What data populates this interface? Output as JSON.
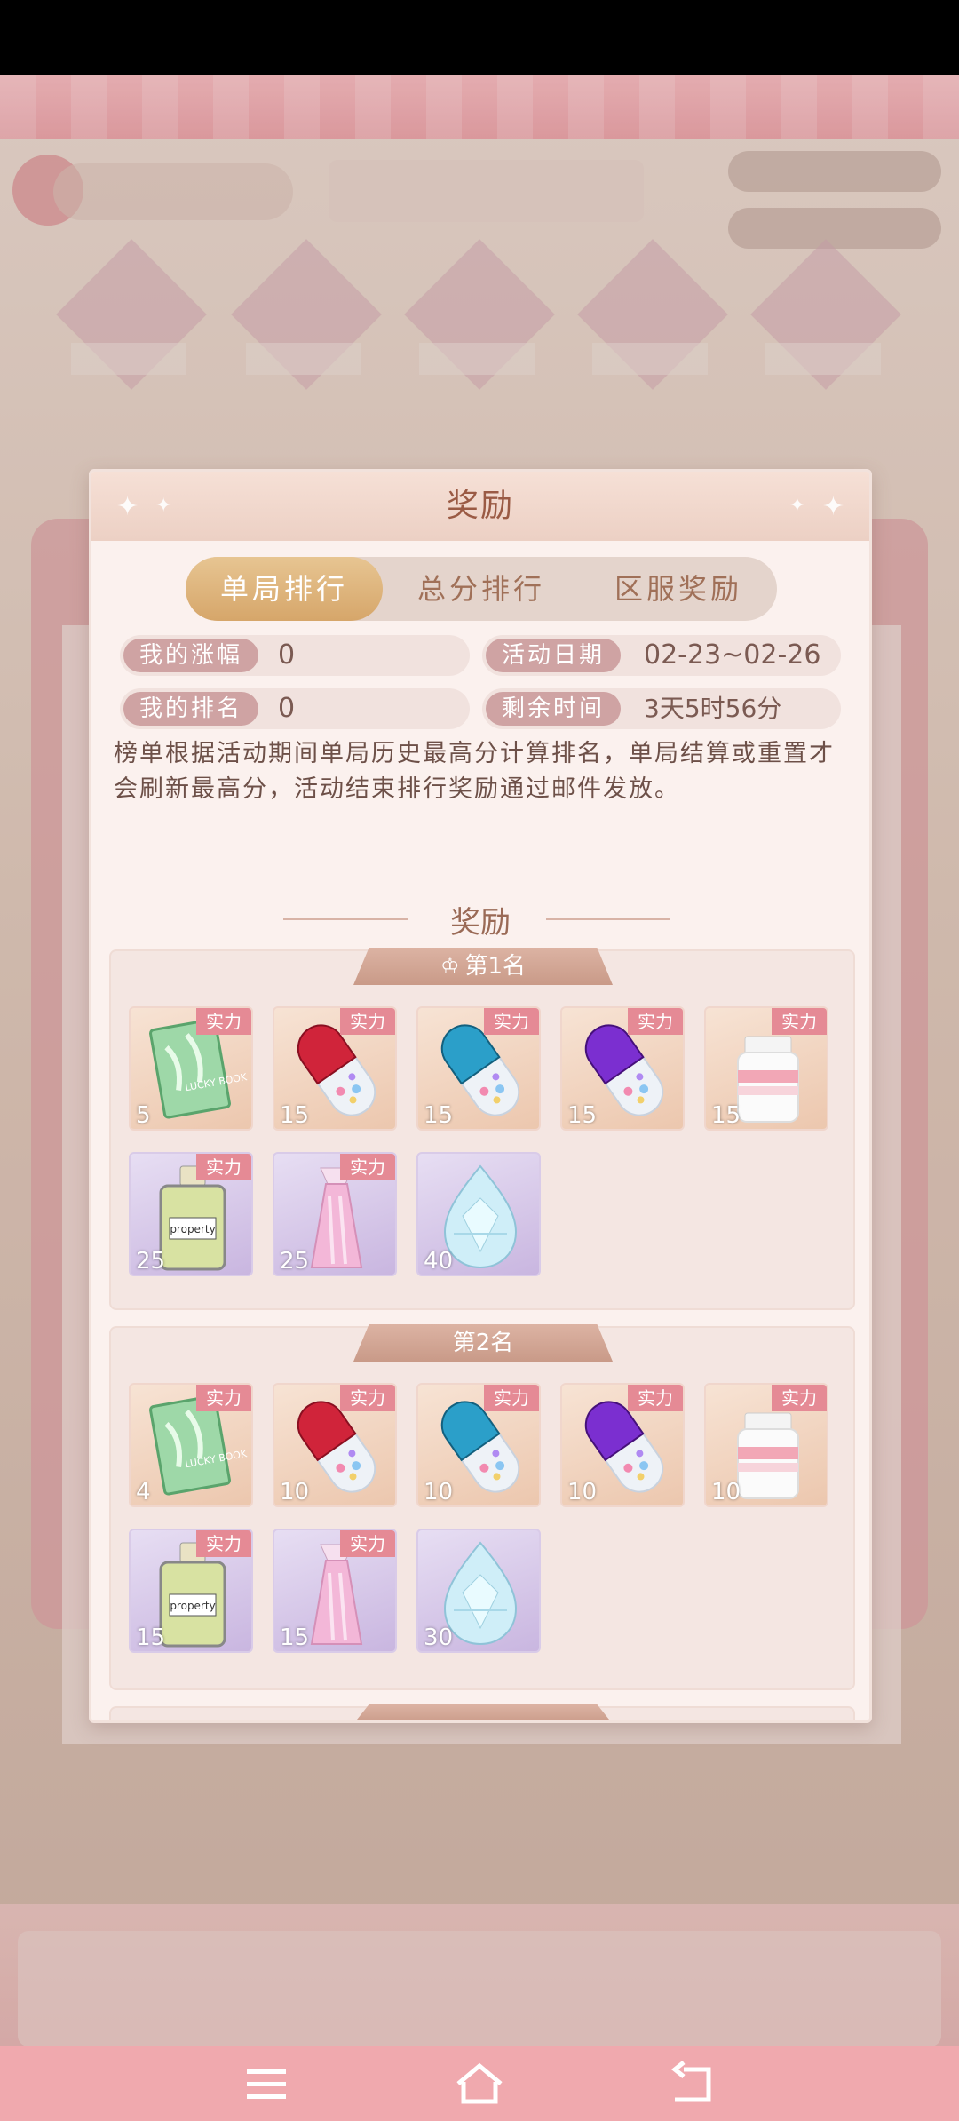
{
  "modal": {
    "title": "奖励",
    "tabs": [
      {
        "label": "单局排行",
        "active": true
      },
      {
        "label": "总分排行",
        "active": false
      },
      {
        "label": "区服奖励",
        "active": false
      }
    ],
    "info": {
      "my_rise_label": "我的涨幅",
      "my_rise_value": "0",
      "my_rank_label": "我的排名",
      "my_rank_value": "0",
      "event_date_label": "活动日期",
      "event_date_value": "02-23~02-26",
      "remaining_label": "剩余时间",
      "remaining_value": "3天5时56分"
    },
    "description": "榜单根据活动期间单局历史最高分计算排名，单局结算或重置才会刷新最高分，活动结束排行奖励通过邮件发放。",
    "rewards_title": "奖励",
    "ranks": [
      {
        "label": "第1名",
        "items": [
          {
            "icon": "lucky-book-icon",
            "qty": "5",
            "badge": "实力"
          },
          {
            "icon": "red-capsule-icon",
            "qty": "15",
            "badge": "实力"
          },
          {
            "icon": "blue-capsule-icon",
            "qty": "15",
            "badge": "实力"
          },
          {
            "icon": "purple-capsule-icon",
            "qty": "15",
            "badge": "实力"
          },
          {
            "icon": "pill-bottle-icon",
            "qty": "15",
            "badge": "实力"
          },
          {
            "icon": "perfume-bottle-icon",
            "qty": "25",
            "badge": "实力",
            "label_text": "property"
          },
          {
            "icon": "pink-potion-icon",
            "qty": "25",
            "badge": "实力"
          },
          {
            "icon": "diamond-icon",
            "qty": "40",
            "badge": ""
          }
        ]
      },
      {
        "label": "第2名",
        "items": [
          {
            "icon": "lucky-book-icon",
            "qty": "4",
            "badge": "实力"
          },
          {
            "icon": "red-capsule-icon",
            "qty": "10",
            "badge": "实力"
          },
          {
            "icon": "blue-capsule-icon",
            "qty": "10",
            "badge": "实力"
          },
          {
            "icon": "purple-capsule-icon",
            "qty": "10",
            "badge": "实力"
          },
          {
            "icon": "pill-bottle-icon",
            "qty": "10",
            "badge": "实力"
          },
          {
            "icon": "perfume-bottle-icon",
            "qty": "15",
            "badge": "实力",
            "label_text": "property"
          },
          {
            "icon": "pink-potion-icon",
            "qty": "15",
            "badge": "实力"
          },
          {
            "icon": "diamond-icon",
            "qty": "30",
            "badge": ""
          }
        ]
      }
    ],
    "book_text": "LUCKY BOOK"
  },
  "colors": {
    "accent_gold": "#d6a66a",
    "badge_pink": "#e58a95",
    "title_brown": "#9a5a44"
  }
}
